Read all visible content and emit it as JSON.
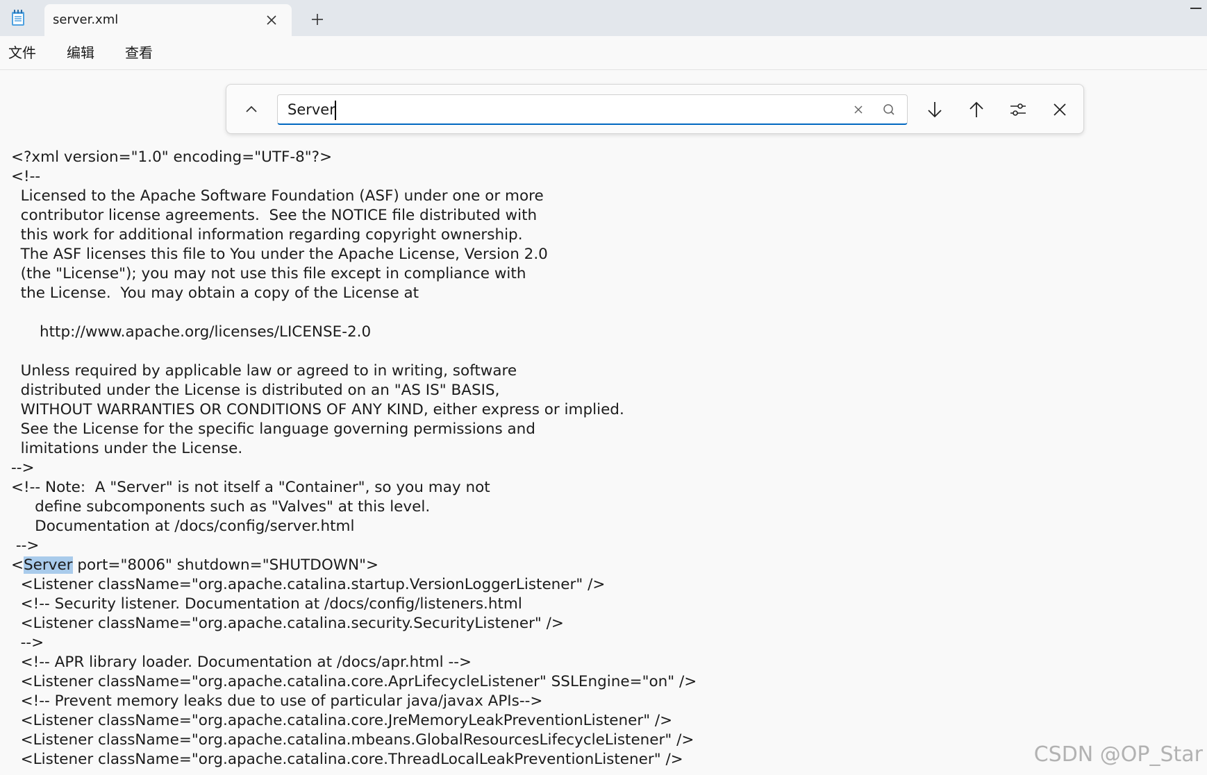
{
  "window": {
    "tab_title": "server.xml",
    "app_icon": "notepad-icon",
    "tab_close_icon": "close-icon",
    "new_tab_icon": "plus-icon",
    "minimize_icon": "minimize-icon"
  },
  "menu": {
    "file": "文件",
    "edit": "编辑",
    "view": "查看"
  },
  "find": {
    "query": "Server",
    "icons": {
      "collapse": "chevron-up-icon",
      "clear": "close-icon",
      "search": "search-icon",
      "next": "arrow-down-icon",
      "previous": "arrow-up-icon",
      "options": "sliders-icon",
      "close": "close-icon"
    }
  },
  "editor": {
    "highlight_color": "#a9cbeb",
    "lines": [
      "<?xml version=\"1.0\" encoding=\"UTF-8\"?>",
      "<!--",
      "  Licensed to the Apache Software Foundation (ASF) under one or more",
      "  contributor license agreements.  See the NOTICE file distributed with",
      "  this work for additional information regarding copyright ownership.",
      "  The ASF licenses this file to You under the Apache License, Version 2.0",
      "  (the \"License\"); you may not use this file except in compliance with",
      "  the License.  You may obtain a copy of the License at",
      "",
      "      http://www.apache.org/licenses/LICENSE-2.0",
      "",
      "  Unless required by applicable law or agreed to in writing, software",
      "  distributed under the License is distributed on an \"AS IS\" BASIS,",
      "  WITHOUT WARRANTIES OR CONDITIONS OF ANY KIND, either express or implied.",
      "  See the License for the specific language governing permissions and",
      "  limitations under the License.",
      "-->",
      "<!-- Note:  A \"Server\" is not itself a \"Container\", so you may not",
      "     define subcomponents such as \"Valves\" at this level.",
      "     Documentation at /docs/config/server.html",
      " -->",
      "",
      "  <Listener className=\"org.apache.catalina.startup.VersionLoggerListener\" />",
      "  <!-- Security listener. Documentation at /docs/config/listeners.html",
      "  <Listener className=\"org.apache.catalina.security.SecurityListener\" />",
      "  -->",
      "  <!-- APR library loader. Documentation at /docs/apr.html -->",
      "  <Listener className=\"org.apache.catalina.core.AprLifecycleListener\" SSLEngine=\"on\" />",
      "  <!-- Prevent memory leaks due to use of particular java/javax APIs-->",
      "  <Listener className=\"org.apache.catalina.core.JreMemoryLeakPreventionListener\" />",
      "  <Listener className=\"org.apache.catalina.mbeans.GlobalResourcesLifecycleListener\" />",
      "  <Listener className=\"org.apache.catalina.core.ThreadLocalLeakPreventionListener\" />"
    ],
    "match_line": {
      "prefix": "<",
      "match": "Server",
      "suffix": " port=\"8006\" shutdown=\"SHUTDOWN\">"
    }
  },
  "watermark": "CSDN @OP_Star"
}
